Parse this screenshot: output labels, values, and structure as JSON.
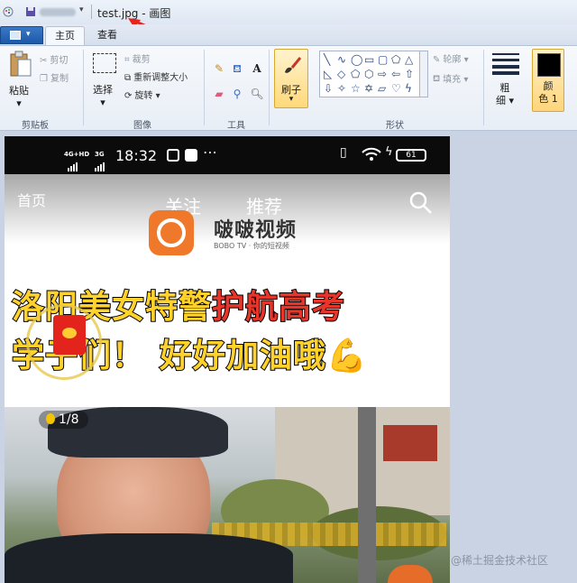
{
  "window": {
    "title_file": "test.jpg",
    "title_sep": " - ",
    "title_app": "画图"
  },
  "tabs": {
    "home": "主页",
    "view": "查看"
  },
  "ribbon": {
    "clipboard": {
      "paste": "粘贴",
      "cut": "剪切",
      "copy": "复制",
      "group": "剪贴板"
    },
    "image": {
      "select": "选择",
      "crop": "裁剪",
      "resize": "重新调整大小",
      "rotate": "旋转",
      "group": "图像"
    },
    "tools": {
      "group": "工具",
      "text_tool": "A"
    },
    "brush": {
      "label": "刷子"
    },
    "shapes": {
      "outline": "轮廓",
      "fill": "填充",
      "group": "形状"
    },
    "size": {
      "label_line1": "粗",
      "label_line2": "细"
    },
    "color1": {
      "label_line1": "颜",
      "label_line2": "色 1",
      "color": "#000000"
    }
  },
  "canvas_image": {
    "phone_status": {
      "net1": "4G+HD",
      "net2": "3G",
      "time": "18:32",
      "icons": "⋯",
      "battery": "61"
    },
    "app": {
      "tab_left": "首页",
      "tab_follow": "关注",
      "tab_recommend": "推荐",
      "logo_name": "啵啵视频",
      "logo_sub": "BOBO TV · 你的短视频"
    },
    "headline": {
      "line1_yellow": "洛阳美女特警",
      "line1_red": "护航高考",
      "line2_yellow": "学子们！",
      "line2_yellow2": "好好加油哦",
      "emoji": "💪"
    },
    "counter": "1/8"
  },
  "watermark": "@稀土掘金技术社区",
  "colors": {
    "accent_tab": "#1c5aa8",
    "arrow": "#e8231c"
  }
}
